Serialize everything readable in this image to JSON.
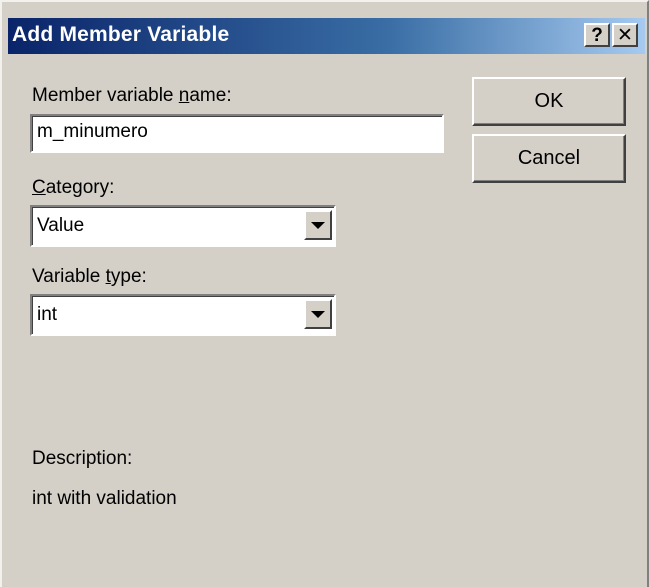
{
  "window": {
    "title": "Add Member Variable",
    "help_glyph": "?",
    "close_glyph": "✕"
  },
  "member_name": {
    "label_pre": "Member variable ",
    "label_accel": "n",
    "label_post": "ame:",
    "value": "m_minumero"
  },
  "category": {
    "label_accel": "C",
    "label_post": "ategory:",
    "selected": "Value"
  },
  "variable_type": {
    "label_pre": "Variable ",
    "label_accel": "t",
    "label_post": "ype:",
    "selected": "int"
  },
  "description": {
    "label": "Description:",
    "text": "int with validation"
  },
  "buttons": {
    "ok": "OK",
    "cancel": "Cancel"
  },
  "icons": [
    "help-icon",
    "close-icon",
    "dropdown-arrow-icon"
  ]
}
